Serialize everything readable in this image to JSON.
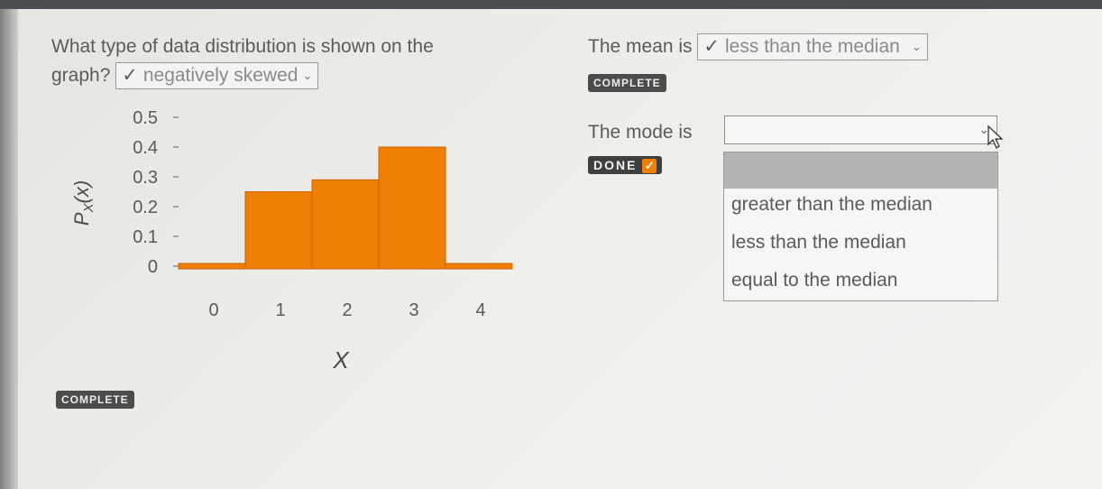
{
  "question1": {
    "line1": "What type of data distribution is shown on the",
    "line2": "graph?",
    "answer_check": "✓",
    "answer": "negatively skewed",
    "status": "COMPLETE"
  },
  "question2": {
    "label": "The mean is",
    "answer_check": "✓",
    "answer": "less than the median",
    "status": "COMPLETE"
  },
  "question3": {
    "label": "The mode is",
    "selected": "",
    "status": "DONE",
    "status_check": "✓",
    "options": [
      "greater than the median",
      "less than the median",
      "equal to the median"
    ]
  },
  "chart_data": {
    "type": "bar",
    "categories": [
      "0",
      "1",
      "2",
      "3",
      "4"
    ],
    "values": [
      0.0,
      0.25,
      0.29,
      0.4,
      0.0
    ],
    "ylabel": "P_X(x)",
    "xlabel": "X",
    "ylim": [
      0,
      0.5
    ],
    "yticks": [
      "0",
      "0.1",
      "0.2",
      "0.3",
      "0.4",
      "0.5"
    ],
    "bar_color": "#f07f06",
    "grid": false
  },
  "colors": {
    "accent": "#f07f06",
    "badge": "#4c4c4c"
  }
}
